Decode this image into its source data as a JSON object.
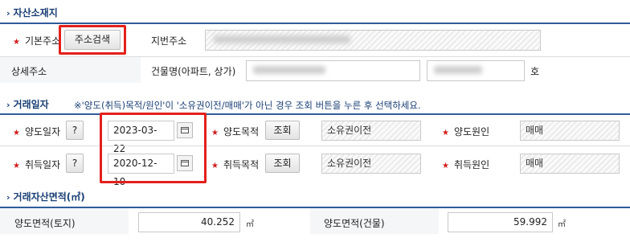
{
  "sections": {
    "location": "자산소재지",
    "trade_date": "거래일자",
    "trade_area": "거래자산면적(㎡)"
  },
  "location": {
    "basic_address_label": "기본주소",
    "search_button": "주소검색",
    "lot_address_label": "지번주소",
    "detail_address_label": "상세주소",
    "building_name_label": "건물명(아파트, 상가)",
    "unit_suffix": "호"
  },
  "trade": {
    "note": "※'양도(취득)목적/원인'이 '소유권이전/매매'가 아닌 경우 조회 버튼을 누른 후 선택하세요.",
    "help_label": "?",
    "lookup_label": "조회",
    "transfer_date_label": "양도일자",
    "transfer_date_value": "2023-03-22",
    "transfer_purpose_label": "양도목적",
    "transfer_purpose_value": "소유권이전",
    "transfer_cause_label": "양도원인",
    "transfer_cause_value": "매매",
    "acquire_date_label": "취득일자",
    "acquire_date_value": "2020-12-10",
    "acquire_purpose_label": "취득목적",
    "acquire_purpose_value": "소유권이전",
    "acquire_cause_label": "취득원인",
    "acquire_cause_value": "매매"
  },
  "area": {
    "land_label": "양도면적(토지)",
    "land_value": "40.252",
    "building_label": "양도면적(건물)",
    "building_value": "59.992",
    "unit": "㎡"
  },
  "icons": {
    "section_marker": "chevron-right-icon",
    "required_marker": "asterisk-icon",
    "calendar": "calendar-icon"
  }
}
